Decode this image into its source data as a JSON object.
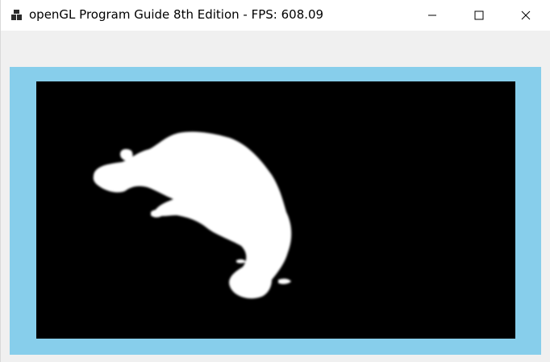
{
  "window": {
    "title": "openGL Program Guide 8th Edition - FPS: 608.09"
  },
  "icons": {
    "app": "app-icon",
    "minimize": "minimize-icon",
    "maximize": "maximize-icon",
    "close": "close-icon"
  },
  "colors": {
    "titlebar": "#ffffff",
    "client_background": "#f0f0f0",
    "clear_color": "#87ceeb",
    "viewport_background": "#000000",
    "blob": "#ffffff"
  }
}
